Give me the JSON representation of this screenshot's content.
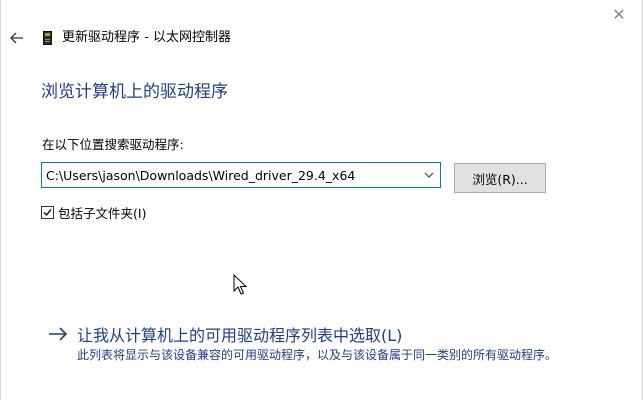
{
  "window": {
    "close_glyph": "✕",
    "title": "更新驱动程序 - 以太网控制器"
  },
  "main": {
    "heading": "浏览计算机上的驱动程序",
    "search_label": "在以下位置搜索驱动程序:",
    "path_value": "C:\\Users\\jason\\Downloads\\Wired_driver_29.4_x64",
    "browse_label": "浏览(R)...",
    "include_subfolders_label": "包括子文件夹(I)",
    "include_subfolders_checked": true
  },
  "pick": {
    "link_text": "让我从计算机上的可用驱动程序列表中选取(L)",
    "description": "此列表将显示与该设备兼容的可用驱动程序，以及与该设备属于同一类别的所有驱动程序。"
  },
  "colors": {
    "accent": "#0078d7",
    "link": "#1f3c96"
  },
  "icons": {
    "back": "back-arrow-icon",
    "device": "network-device-icon",
    "dropdown": "chevron-down-icon",
    "checkbox": "checkmark-icon",
    "link_arrow": "right-arrow-icon",
    "cursor": "mouse-pointer-icon"
  }
}
